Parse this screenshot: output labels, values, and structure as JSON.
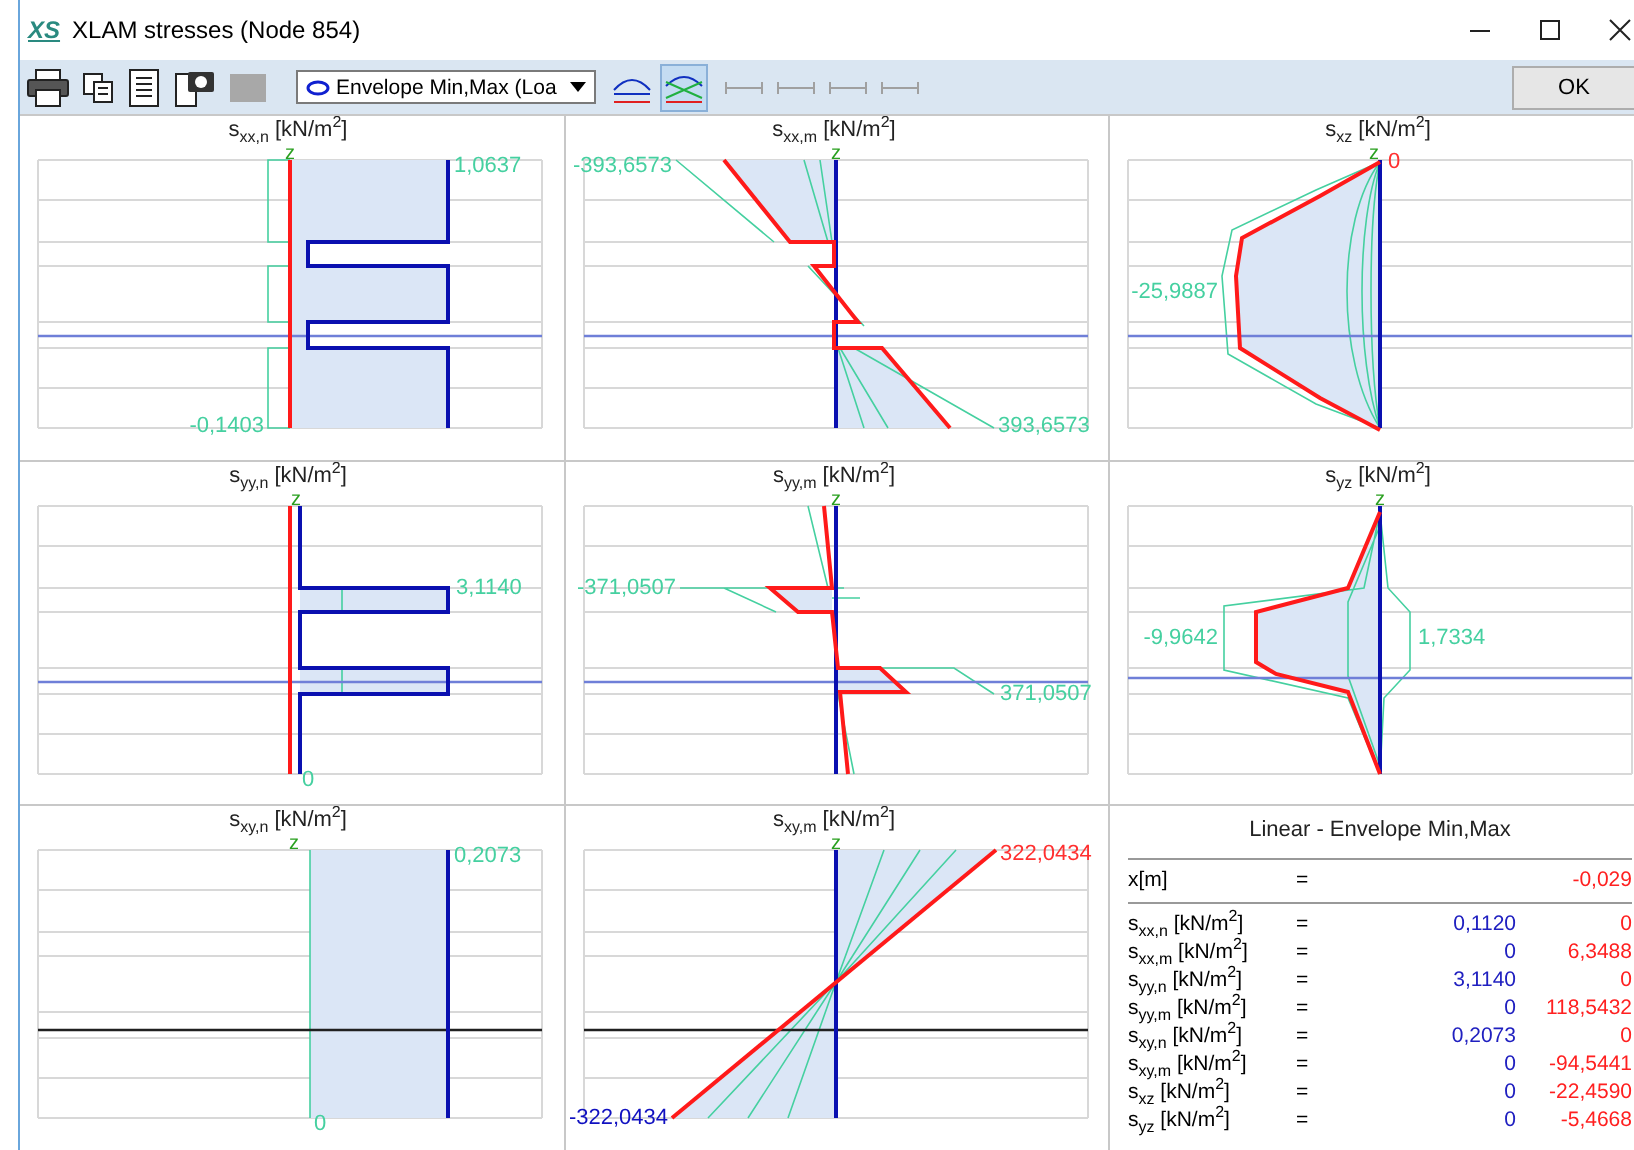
{
  "window": {
    "logo": "XS",
    "title": "XLAM stresses (Node 854)"
  },
  "toolbar": {
    "buttons": [
      {
        "kind": "print",
        "disabled": false
      },
      {
        "kind": "copy",
        "disabled": false
      },
      {
        "kind": "list",
        "disabled": false
      },
      {
        "kind": "camera",
        "disabled": false
      },
      {
        "kind": "image",
        "disabled": true
      }
    ],
    "dropdown": {
      "value": "Envelope Min,Max (Loa"
    },
    "view_buttons": [
      {
        "kind": "curves",
        "selected": false
      },
      {
        "kind": "envelope",
        "selected": true
      }
    ],
    "line_buttons": [
      {
        "disabled": true
      },
      {
        "disabled": true
      },
      {
        "disabled": true
      },
      {
        "disabled": true
      }
    ],
    "ok": "OK"
  },
  "panels": [
    {
      "title": "s$_{xx,n}$ [kN/m$^{2}$]",
      "kind": "stepped",
      "axis_label": "z",
      "labels": [
        {
          "text": "1,0637",
          "color": "#45d0a0"
        },
        {
          "text": "-0,1403",
          "color": "#45d0a0"
        }
      ]
    },
    {
      "title": "s$_{xx,m}$ [kN/m$^{2}$]",
      "kind": "linear",
      "axis_label": "z",
      "labels": [
        {
          "text": "-393,6573",
          "color": "#45d0a0"
        },
        {
          "text": "393,6573",
          "color": "#45d0a0"
        }
      ]
    },
    {
      "title": "s$_{xz}$ [kN/m$^{2}$]",
      "kind": "parabolic",
      "axis_label": "z",
      "labels": [
        {
          "text": "0",
          "color": "#ff3030"
        },
        {
          "text": "-25,9887",
          "color": "#45d0a0"
        }
      ]
    },
    {
      "title": "s$_{yy,n}$ [kN/m$^{2}$]",
      "kind": "flange",
      "axis_label": "z",
      "labels": [
        {
          "text": "3,1140",
          "color": "#45d0a0"
        },
        {
          "text": "0",
          "color": "#45d0a0"
        }
      ]
    },
    {
      "title": "s$_{yy,m}$ [kN/m$^{2}$]",
      "kind": "flange-moment",
      "axis_label": "z",
      "labels": [
        {
          "text": "-371,0507",
          "color": "#45d0a0"
        },
        {
          "text": "371,0507",
          "color": "#45d0a0"
        }
      ]
    },
    {
      "title": "s$_{yz}$ [kN/m$^{2}$]",
      "kind": "star",
      "axis_label": "z",
      "labels": [
        {
          "text": "-9,9642",
          "color": "#45d0a0"
        },
        {
          "text": "1,7334",
          "color": "#45d0a0"
        }
      ]
    },
    {
      "title": "s$_{xy,n}$ [kN/m$^{2}$]",
      "kind": "band",
      "axis_label": "z",
      "labels": [
        {
          "text": "0,2073",
          "color": "#45d0a0"
        },
        {
          "text": "0",
          "color": "#45d0a0"
        }
      ]
    },
    {
      "title": "s$_{xy,m}$ [kN/m$^{2}$]",
      "kind": "diagonal",
      "axis_label": "z",
      "labels": [
        {
          "text": "322,0434",
          "color": "#ff3030"
        },
        {
          "text": "-322,0434",
          "color": "#1010c0"
        }
      ]
    }
  ],
  "results": {
    "title": "Linear - Envelope Min,Max",
    "position": {
      "label": "x[m]",
      "eq": "=",
      "value": "-0,029"
    },
    "rows": [
      {
        "label": "s$_{xx,n}$ [kN/m$^{2}$]",
        "eq": "=",
        "min": "0,1120",
        "max": "0"
      },
      {
        "label": "s$_{xx,m}$ [kN/m$^{2}$]",
        "eq": "=",
        "min": "0",
        "max": "6,3488"
      },
      {
        "label": "s$_{yy,n}$ [kN/m$^{2}$]",
        "eq": "=",
        "min": "3,1140",
        "max": "0"
      },
      {
        "label": "s$_{yy,m}$ [kN/m$^{2}$]",
        "eq": "=",
        "min": "0",
        "max": "118,5432"
      },
      {
        "label": "s$_{xy,n}$ [kN/m$^{2}$]",
        "eq": "=",
        "min": "0,2073",
        "max": "0"
      },
      {
        "label": "s$_{xy,m}$ [kN/m$^{2}$]",
        "eq": "=",
        "min": "0",
        "max": "-94,5441"
      },
      {
        "label": "s$_{xz}$ [kN/m$^{2}$]",
        "eq": "=",
        "min": "0",
        "max": "-22,4590"
      },
      {
        "label": "s$_{yz}$ [kN/m$^{2}$]",
        "eq": "=",
        "min": "0",
        "max": "-5,4668"
      }
    ]
  }
}
